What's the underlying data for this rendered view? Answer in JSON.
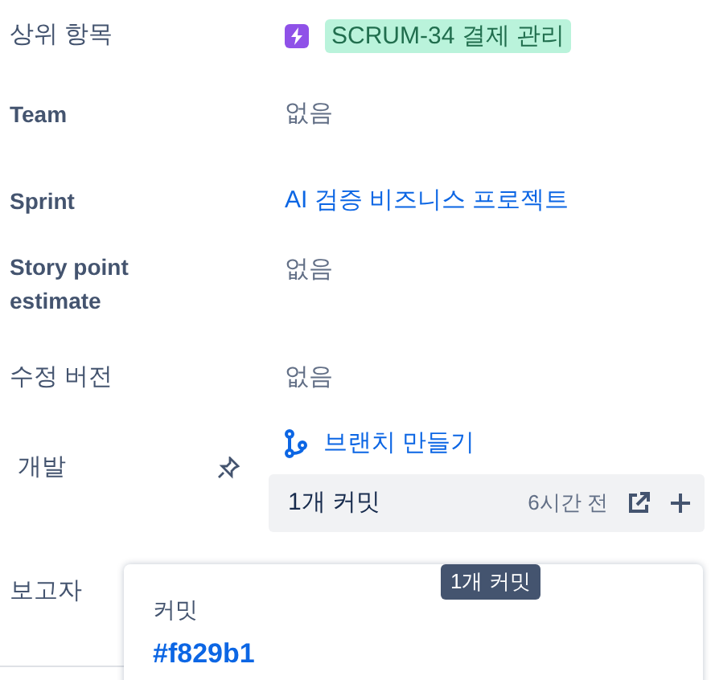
{
  "fields": [
    {
      "label": "상위 항목",
      "kind": "parent",
      "value": "SCRUM-34 결제 관리"
    },
    {
      "label": "Team",
      "kind": "empty",
      "value": "없음"
    },
    {
      "label": "Sprint",
      "kind": "link",
      "value": "AI 검증 비즈니스 프로젝트"
    },
    {
      "label": "Story point estimate",
      "kind": "empty",
      "value": "없음"
    },
    {
      "label": "수정 버전",
      "kind": "empty",
      "value": "없음"
    },
    {
      "label": "개발",
      "kind": "development",
      "branch_link": "브랜치 만들기",
      "commits": "1개 커밋",
      "time": "6시간 전"
    },
    {
      "label": "보고자",
      "kind": "reporter"
    }
  ],
  "tooltip": "1개 커밋",
  "popup": {
    "title": "커밋",
    "hash": "#f829b1"
  }
}
